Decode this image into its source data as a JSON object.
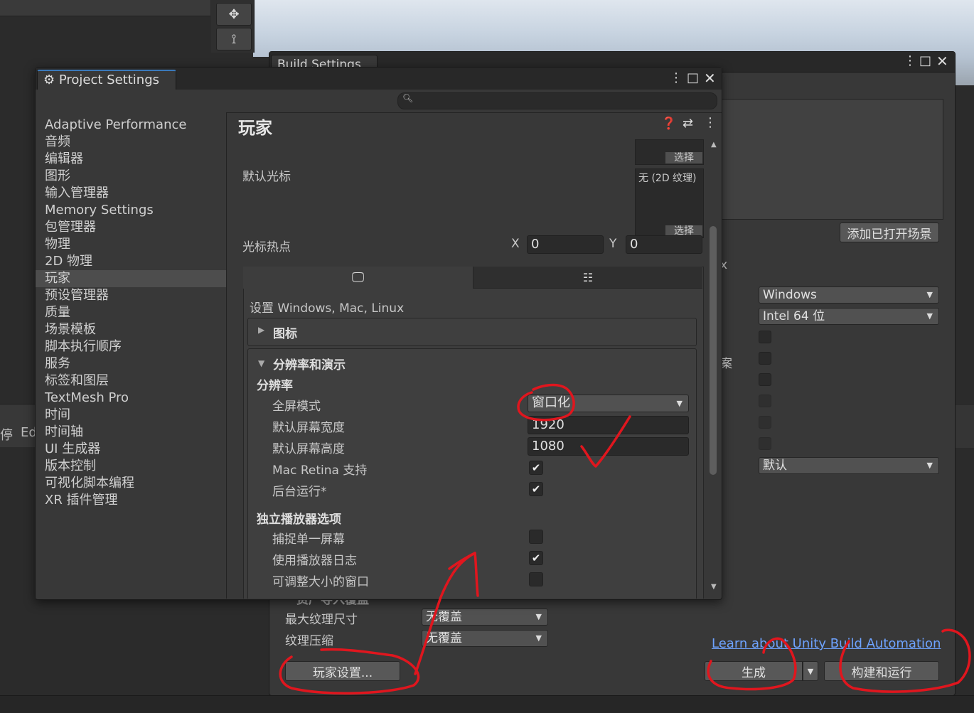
{
  "build_settings": {
    "tab_title": "Build Settings",
    "add_open_scenes": "添加已打开场景",
    "target_platform": "Windows",
    "architecture": "Intel 64 位",
    "partial_text_x": "x",
    "partial_text_an": "案",
    "compression": "默认",
    "max_texture_size_label": "最大纹理尺寸",
    "max_texture_size_value": "无覆盖",
    "texture_compression_label": "纹理压缩",
    "texture_compression_value": "无覆盖",
    "partial_label": "资产导入覆盖",
    "learn_link": "Learn about Unity Build Automation",
    "player_settings_button": "玩家设置...",
    "build_button": "生成",
    "build_and_run_button": "构建和运行"
  },
  "left_panel": {
    "tab_pause": "停",
    "tab_ed": "Ed"
  },
  "project_settings": {
    "tab_title": "Project Settings",
    "sidebar": [
      "Adaptive Performance",
      "音频",
      "编辑器",
      "图形",
      "输入管理器",
      "Memory Settings",
      "包管理器",
      "物理",
      "2D 物理",
      "玩家",
      "预设管理器",
      "质量",
      "场景模板",
      "脚本执行顺序",
      "服务",
      "标签和图层",
      "TextMesh Pro",
      "时间",
      "时间轴",
      "UI 生成器",
      "版本控制",
      "可视化脚本编程",
      "XR 插件管理"
    ],
    "selected_index": 9,
    "main": {
      "title": "玩家",
      "select_label": "选择",
      "default_cursor_label": "默认光标",
      "cursor_none": "无 (2D 纹理)",
      "cursor_hotspot_label": "光标热点",
      "hotspot_x_label": "X",
      "hotspot_x": "0",
      "hotspot_y_label": "Y",
      "hotspot_y": "0",
      "platform_heading": "设置 Windows, Mac, Linux",
      "icon_section": "图标",
      "resolution_section": "分辨率和演示",
      "resolution_sub": "分辨率",
      "fullscreen_mode_label": "全屏模式",
      "fullscreen_mode_value": "窗口化",
      "default_width_label": "默认屏幕宽度",
      "default_width": "1920",
      "default_height_label": "默认屏幕高度",
      "default_height": "1080",
      "mac_retina_label": "Mac Retina 支持",
      "mac_retina": true,
      "run_in_background_label": "后台运行*",
      "run_in_background": true,
      "standalone_section": "独立播放器选项",
      "capture_single_label": "捕捉单一屏幕",
      "capture_single": false,
      "player_log_label": "使用播放器日志",
      "player_log": true,
      "resizable_label": "可调整大小的窗口",
      "resizable": false
    }
  },
  "colors": {
    "annotation": "#e0161e",
    "link": "#6ea3ff",
    "selection": "#4d4d4d"
  }
}
